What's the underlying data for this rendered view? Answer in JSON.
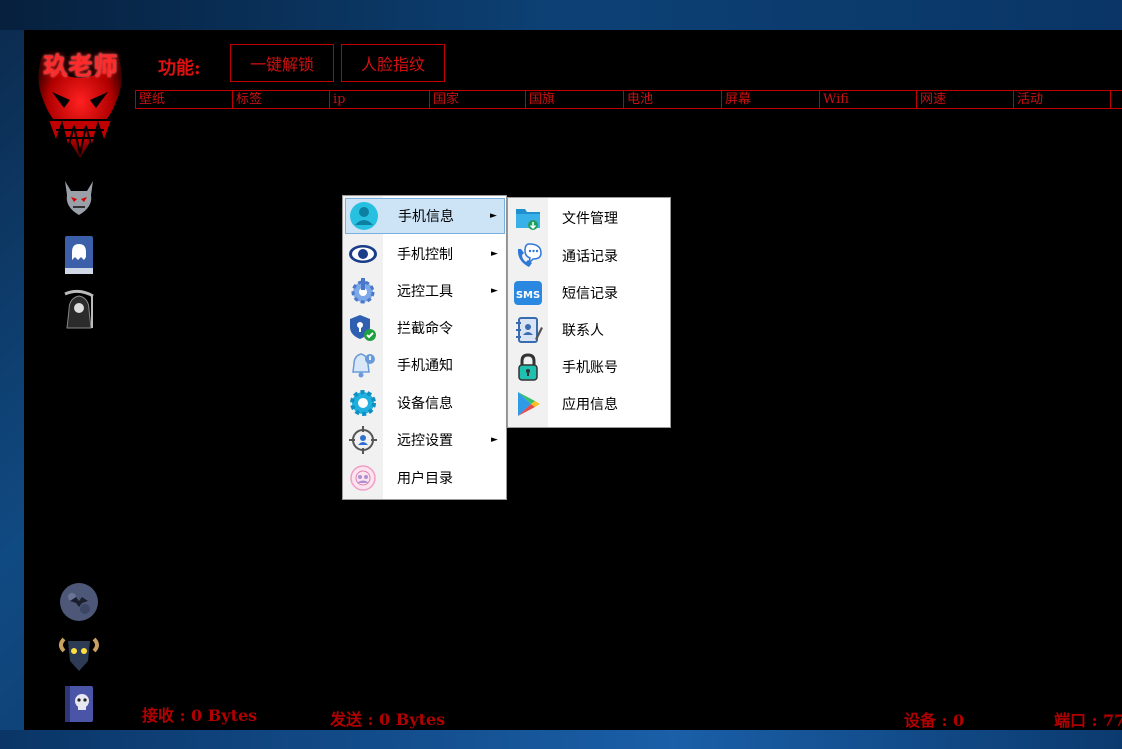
{
  "logo": {
    "text": "玖老师"
  },
  "toolbar": {
    "function_label": "功能:",
    "unlock_label": "一键解锁",
    "face_label": "人脸指纹"
  },
  "table": {
    "columns": [
      "壁纸",
      "标签",
      "ip",
      "国家",
      "国旗",
      "电池",
      "屏幕",
      "Wifi",
      "网速",
      "活动",
      ""
    ]
  },
  "side_icons": [
    "devil-mask-icon",
    "ghost-book-icon",
    "grim-reaper-icon",
    "moon-bat-icon",
    "ram-skull-icon",
    "skull-book-icon"
  ],
  "context_menu": {
    "items": [
      {
        "label": "手机信息",
        "icon": "contact-icon",
        "has_submenu": true,
        "highlighted": true
      },
      {
        "label": "手机控制",
        "icon": "eye-icon",
        "has_submenu": true
      },
      {
        "label": "远控工具",
        "icon": "gear-tool-icon",
        "has_submenu": true
      },
      {
        "label": "拦截命令",
        "icon": "shield-icon",
        "has_submenu": false
      },
      {
        "label": "手机通知",
        "icon": "bell-icon",
        "has_submenu": false
      },
      {
        "label": "设备信息",
        "icon": "settings-icon",
        "has_submenu": false
      },
      {
        "label": "远控设置",
        "icon": "target-user-icon",
        "has_submenu": true
      },
      {
        "label": "用户目录",
        "icon": "user-directory-icon",
        "has_submenu": false
      }
    ],
    "arrow": "►"
  },
  "submenu": {
    "items": [
      {
        "label": "文件管理",
        "icon": "folder-icon"
      },
      {
        "label": "通话记录",
        "icon": "phone-call-icon"
      },
      {
        "label": "短信记录",
        "icon": "sms-icon"
      },
      {
        "label": "联系人",
        "icon": "address-book-icon"
      },
      {
        "label": "手机账号",
        "icon": "padlock-icon"
      },
      {
        "label": "应用信息",
        "icon": "play-store-icon"
      }
    ],
    "sms_text": "SMS"
  },
  "status": {
    "receive": "接收 : 0 Bytes",
    "send": "发送 : 0 Bytes",
    "devices": "设备 : 0",
    "port": "端口 : 77"
  },
  "colors": {
    "accent_red": "#c00000",
    "menu_highlight": "#cde4f7"
  }
}
